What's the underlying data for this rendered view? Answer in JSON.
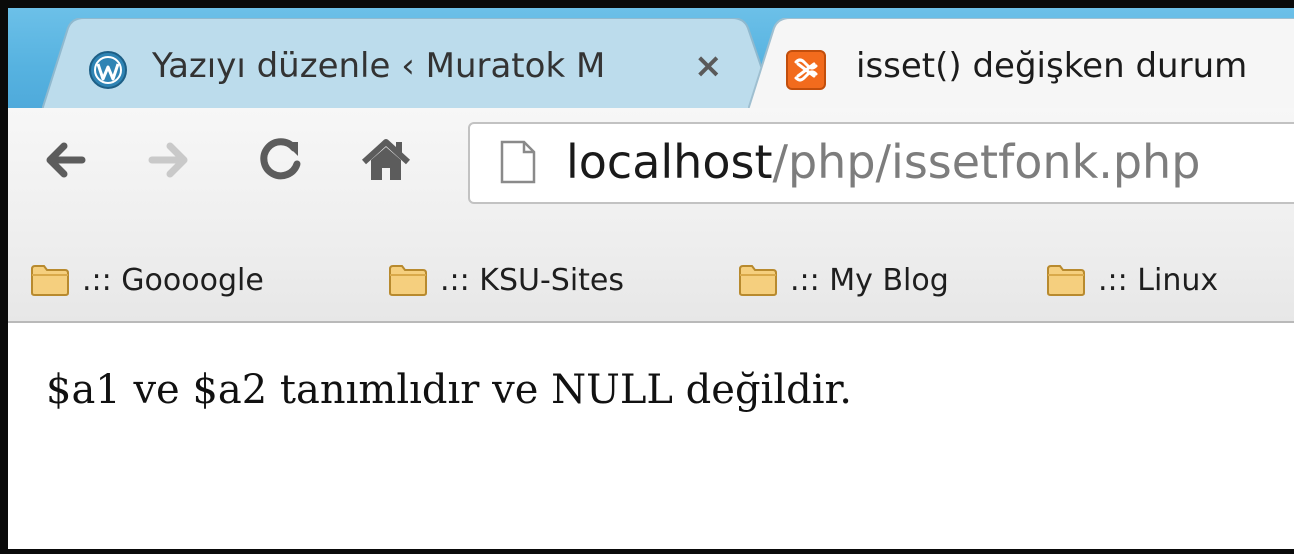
{
  "tabs": [
    {
      "title": "Yazıyı düzenle ‹ Muratok M",
      "icon": "wordpress-icon",
      "active": false,
      "close_label": "×"
    },
    {
      "title": "isset() değişken durum",
      "icon": "xampp-icon",
      "active": true
    }
  ],
  "toolbar": {
    "back_icon": "arrow-left-icon",
    "forward_icon": "arrow-right-icon",
    "reload_icon": "reload-icon",
    "home_icon": "home-icon"
  },
  "address_bar": {
    "host": "localhost",
    "path": "/php/issetfonk.php",
    "icon": "page-icon"
  },
  "bookmarks": [
    {
      "label": ".:: Goooogle",
      "icon": "folder-icon"
    },
    {
      "label": ".:: KSU-Sites",
      "icon": "folder-icon"
    },
    {
      "label": ".:: My Blog",
      "icon": "folder-icon"
    },
    {
      "label": ".:: Linux",
      "icon": "folder-icon"
    }
  ],
  "page": {
    "text": "$a1 ve $a2 tanımlıdır ve NULL değildir."
  },
  "colors": {
    "tabstrip": "#56b2e0",
    "inactive_tab": "#b9d9ea",
    "active_tab": "#f4f4f4",
    "url_path": "#7d7d7d",
    "folder": "#f3c76a"
  }
}
